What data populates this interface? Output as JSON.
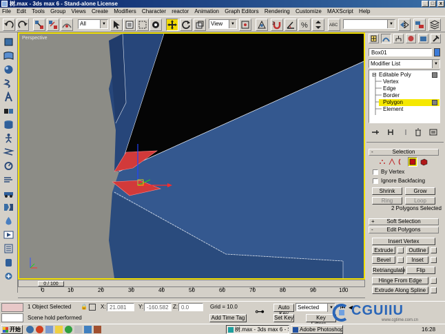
{
  "window": {
    "title": "树.max - 3ds max 6 - Stand-alone License",
    "minimize": "_",
    "maximize": "□",
    "close": "x"
  },
  "menu": [
    "File",
    "Edit",
    "Tools",
    "Group",
    "Views",
    "Create",
    "Modifiers",
    "Character",
    "reactor",
    "Animation",
    "Graph Editors",
    "Rendering",
    "Customize",
    "MAXScript",
    "Help"
  ],
  "toolbar": {
    "selection_filter": "All",
    "reference_coord": "View"
  },
  "viewport": {
    "label": "Perspective",
    "border_color": "#f2e000",
    "background_color": "#8c8c86",
    "mesh_color": "#34588f"
  },
  "timeline": {
    "slider_label": "0 / 100",
    "ticks": [
      "0",
      "10",
      "20",
      "30",
      "40",
      "50",
      "60",
      "70",
      "80",
      "90",
      "100"
    ]
  },
  "command_panel": {
    "object_name": "Box01",
    "object_color": "#3c7bd8",
    "modifier_list": "Modifier List",
    "stack": {
      "root": "Editable Poly",
      "items": [
        "Vertex",
        "Edge",
        "Border",
        "Polygon",
        "Element"
      ],
      "selected": "Polygon"
    },
    "selection": {
      "header": "Selection",
      "by_vertex": "By Vertex",
      "ignore_backfacing": "Ignore Backfacing",
      "shrink": "Shrink",
      "grow": "Grow",
      "ring": "Ring",
      "loop": "Loop",
      "status": "2 Polygons Selected"
    },
    "soft_selection": {
      "header": "Soft Selection"
    },
    "edit_polygons": {
      "header": "Edit Polygons",
      "insert_vertex": "Insert Vertex",
      "extrude": "Extrude",
      "outline": "Outline",
      "bevel": "Bevel",
      "inset": "Inset",
      "retriangulate": "Retriangulate",
      "flip": "Flip",
      "hinge_from_edge": "Hinge From Edge",
      "extrude_along_spline": "Extrude Along Spline"
    }
  },
  "status": {
    "selection_count": "1 Object Selected",
    "prompt": "Scene hold performed",
    "x_label": "X:",
    "x_value": "21.081",
    "y_label": "Y:",
    "y_value": "-160.582",
    "z_label": "Z:",
    "z_value": "0.0",
    "grid": "Grid = 10.0",
    "add_time_tag": "Add Time Tag",
    "auto_key": "Auto Key",
    "set_key": "Set Key",
    "key_mode": "Selected",
    "key_filters": "Key Filters..."
  },
  "taskbar": {
    "start": "开始",
    "tasks": [
      "树.max - 3ds max 6 - S...",
      "Adobe Photoshop"
    ],
    "clock": "16:28"
  },
  "watermark": {
    "brand": "CGUIIU",
    "site": "www.cgtime.com.cn"
  }
}
